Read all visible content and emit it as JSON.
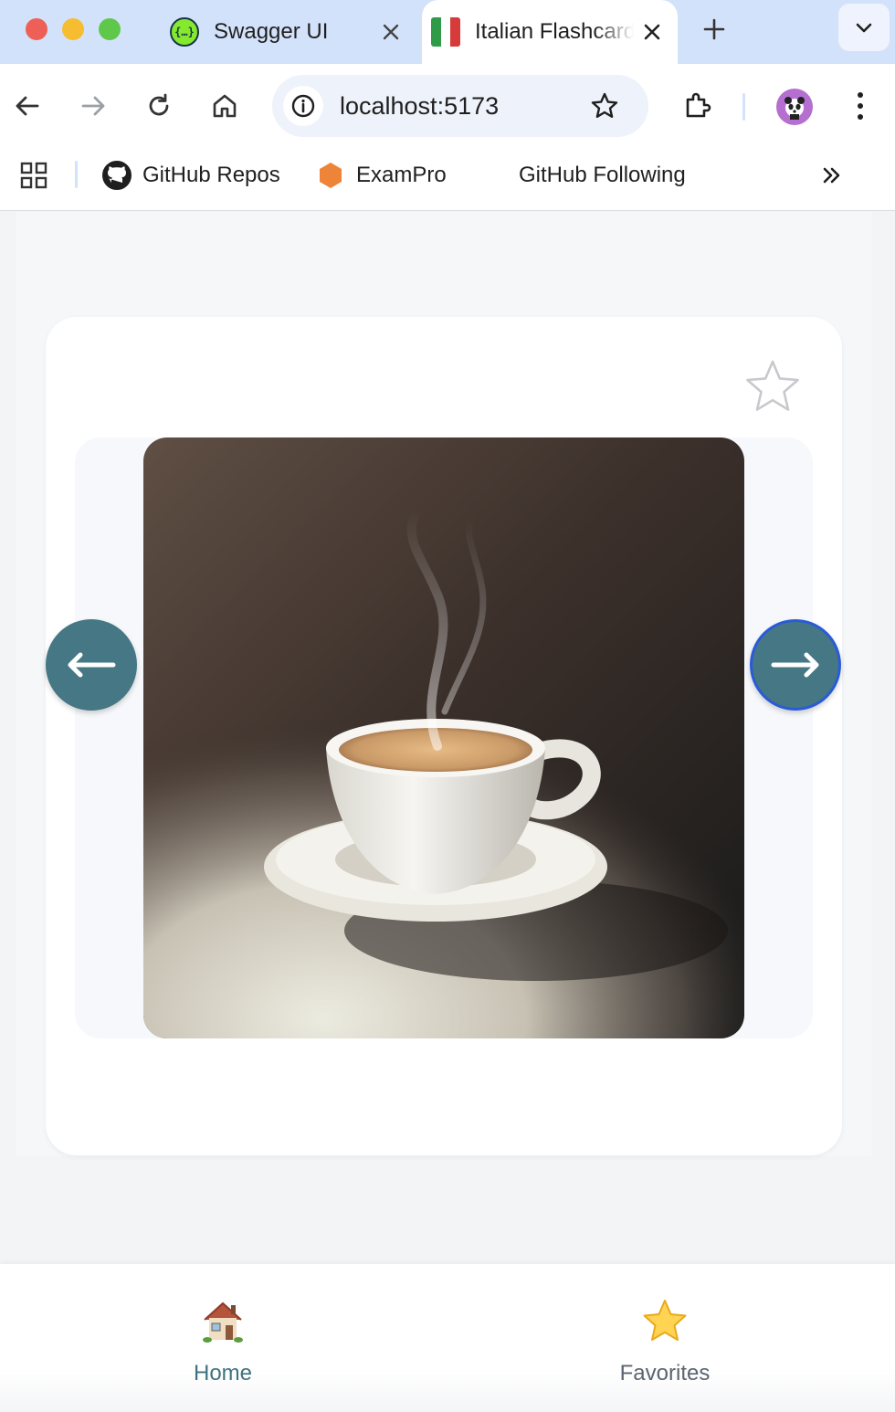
{
  "browser": {
    "tabs": [
      {
        "title": "Swagger UI",
        "favicon": "swagger-icon",
        "active": false
      },
      {
        "title": "Italian Flashcards",
        "favicon": "italy-flag-icon",
        "active": true
      }
    ],
    "address": {
      "url": "localhost:5173"
    },
    "bookmarks": [
      {
        "label": "GitHub Repos",
        "icon": "github-icon"
      },
      {
        "label": "ExamPro",
        "icon": "hexagon-icon"
      },
      {
        "label": "GitHub Following",
        "icon": ""
      }
    ],
    "colors": {
      "tabbar": "#d3e2fb",
      "active_tab": "#ffffff"
    }
  },
  "flashcard": {
    "image": "espresso cup with steam on saucer",
    "favorite": false,
    "prev_icon": "arrow-left-icon",
    "next_icon": "arrow-right-icon",
    "accent": "#457785"
  },
  "bottom_nav": {
    "items": [
      {
        "label": "Home",
        "icon": "house-icon",
        "active": true
      },
      {
        "label": "Favorites",
        "icon": "star-icon",
        "active": false
      }
    ],
    "active_color": "#3f7281"
  }
}
